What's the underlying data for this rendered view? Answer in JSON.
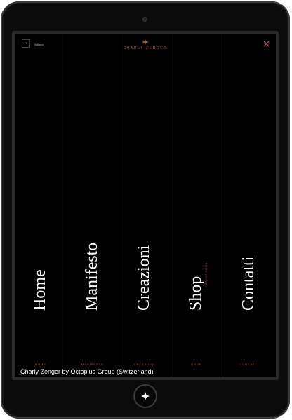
{
  "brand": {
    "name": "CHARLY ZENGER",
    "accent_color": "#c0643f"
  },
  "topbar": {
    "lang_box": "IT",
    "lang_label": "Italiano",
    "close_icon": "close-icon"
  },
  "menu": [
    {
      "title": "Home",
      "footer": "HOME"
    },
    {
      "title": "Manifesto",
      "footer": "MANIFESTO"
    },
    {
      "title": "Creazioni",
      "footer": "CREAZIONI"
    },
    {
      "title": "Shop",
      "footer": "SHOP",
      "badge": "COMING SOON"
    },
    {
      "title": "Contatti",
      "footer": "CONTATTI"
    }
  ],
  "caption": "Charly Zenger by Octoplus Group (Switzerland)"
}
